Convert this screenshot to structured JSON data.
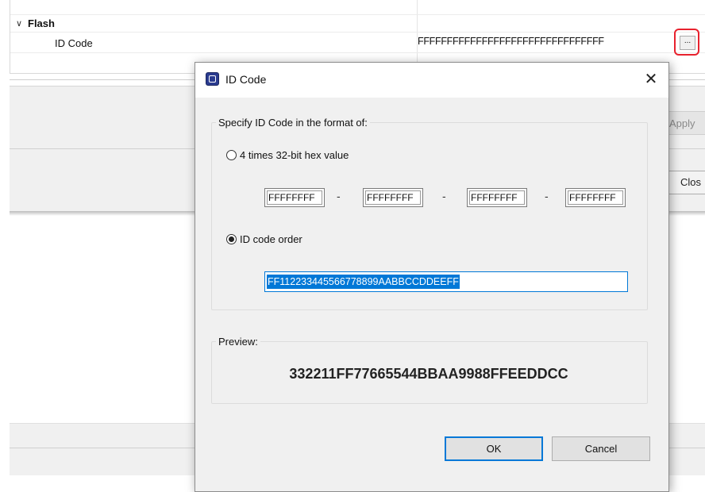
{
  "background": {
    "property_table": {
      "group_label": "Flash",
      "group_chevron": "chevron-down-icon",
      "row_label": "ID Code",
      "row_value": "FFFFFFFFFFFFFFFFFFFFFFFFFFFFFFFF",
      "ellipsis_label": "...",
      "highlight_color": "#e8222e"
    },
    "apply_label": "Apply",
    "close_label": "Clos"
  },
  "dialog": {
    "title": "ID Code",
    "title_icon": "app-icon",
    "close_icon": "close-icon",
    "format_group": {
      "legend": "Specify ID Code in the format of:",
      "option_hex": {
        "label": "4 times 32-bit hex value",
        "checked": false
      },
      "hex_values": [
        "FFFFFFFF",
        "FFFFFFFF",
        "FFFFFFFF",
        "FFFFFFFF"
      ],
      "separator": "-",
      "option_order": {
        "label": "ID code order",
        "checked": true
      },
      "code_value": "FF112233445566778899AABBCCDDEEFF"
    },
    "preview_group": {
      "legend": "Preview:",
      "value": "332211FF77665544BBAA9988FFEEDDCC"
    },
    "ok_label": "OK",
    "cancel_label": "Cancel",
    "accent_color": "#0078d7"
  }
}
